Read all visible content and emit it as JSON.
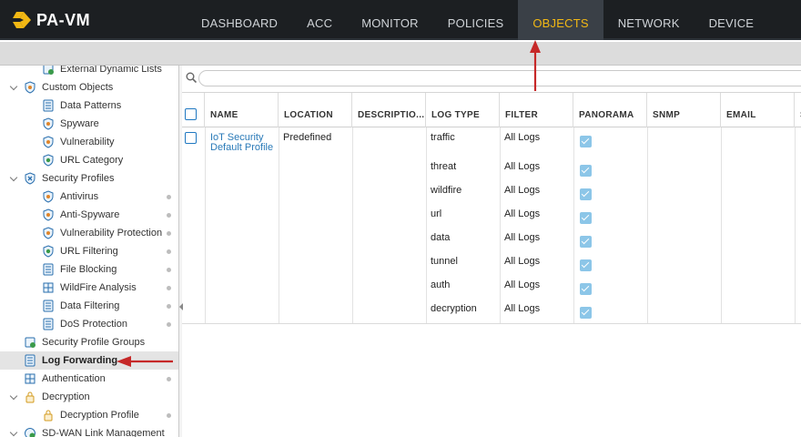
{
  "app": {
    "title": "PA-VM",
    "colors": {
      "accent": "#f2b814",
      "link": "#2a7ab8",
      "annotation": "#c62828",
      "topbar": "#1c1f22"
    }
  },
  "nav": {
    "items": [
      {
        "label": "DASHBOARD"
      },
      {
        "label": "ACC"
      },
      {
        "label": "MONITOR"
      },
      {
        "label": "POLICIES"
      },
      {
        "label": "OBJECTS",
        "active": true
      },
      {
        "label": "NETWORK"
      },
      {
        "label": "DEVICE"
      }
    ]
  },
  "sidebar": {
    "items": [
      {
        "label": "External Dynamic Lists",
        "icon": "external-list-icon"
      },
      {
        "label": "Custom Objects",
        "icon": "custom-objects-icon",
        "expanded": true
      },
      {
        "label": "Data Patterns",
        "icon": "data-patterns-icon"
      },
      {
        "label": "Spyware",
        "icon": "spyware-icon"
      },
      {
        "label": "Vulnerability",
        "icon": "vulnerability-icon"
      },
      {
        "label": "URL Category",
        "icon": "url-category-icon"
      },
      {
        "label": "Security Profiles",
        "icon": "security-profiles-icon",
        "expanded": true
      },
      {
        "label": "Antivirus",
        "icon": "antivirus-icon"
      },
      {
        "label": "Anti-Spyware",
        "icon": "anti-spyware-icon"
      },
      {
        "label": "Vulnerability Protection",
        "icon": "vulnerability-protection-icon"
      },
      {
        "label": "URL Filtering",
        "icon": "url-filtering-icon"
      },
      {
        "label": "File Blocking",
        "icon": "file-blocking-icon"
      },
      {
        "label": "WildFire Analysis",
        "icon": "wildfire-analysis-icon"
      },
      {
        "label": "Data Filtering",
        "icon": "data-filtering-icon"
      },
      {
        "label": "DoS Protection",
        "icon": "dos-protection-icon"
      },
      {
        "label": "Security Profile Groups",
        "icon": "profile-groups-icon"
      },
      {
        "label": "Log Forwarding",
        "icon": "log-forwarding-icon",
        "selected": true
      },
      {
        "label": "Authentication",
        "icon": "authentication-icon"
      },
      {
        "label": "Decryption",
        "icon": "decryption-icon",
        "expanded": true
      },
      {
        "label": "Decryption Profile",
        "icon": "decryption-profile-icon"
      },
      {
        "label": "SD-WAN Link Management",
        "icon": "sdwan-icon",
        "expanded": true
      }
    ]
  },
  "search": {
    "placeholder": "",
    "value": ""
  },
  "table": {
    "columns": [
      "NAME",
      "LOCATION",
      "DESCRIPTIO...",
      "LOG TYPE",
      "FILTER",
      "PANORAMA",
      "SNMP",
      "EMAIL",
      "S"
    ],
    "rows": [
      {
        "name": "IoT Security Default Profile",
        "location": "Predefined",
        "description": "",
        "entries": [
          {
            "log_type": "traffic",
            "filter": "All Logs",
            "panorama": true
          },
          {
            "log_type": "threat",
            "filter": "All Logs",
            "panorama": true
          },
          {
            "log_type": "wildfire",
            "filter": "All Logs",
            "panorama": true
          },
          {
            "log_type": "url",
            "filter": "All Logs",
            "panorama": true
          },
          {
            "log_type": "data",
            "filter": "All Logs",
            "panorama": true
          },
          {
            "log_type": "tunnel",
            "filter": "All Logs",
            "panorama": true
          },
          {
            "log_type": "auth",
            "filter": "All Logs",
            "panorama": true
          },
          {
            "log_type": "decryption",
            "filter": "All Logs",
            "panorama": true
          }
        ]
      }
    ]
  }
}
